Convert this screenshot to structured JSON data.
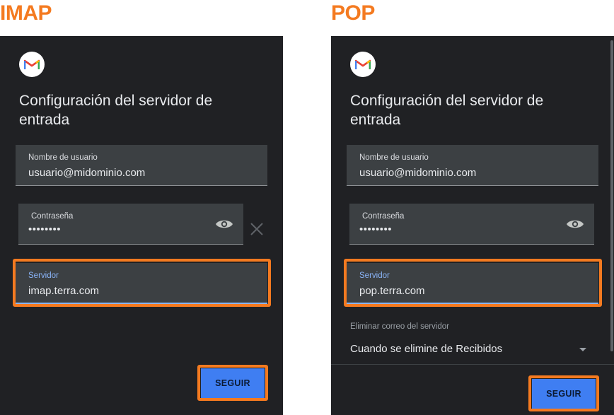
{
  "colors": {
    "accent": "#f47a20",
    "panel": "#202124",
    "field": "#3c4043",
    "button": "#3f7ef2",
    "focus": "#8ab4f8"
  },
  "imap": {
    "heading": "IMAP",
    "logo_icon": "gmail-logo-icon",
    "title": "Configuración del servidor de entrada",
    "username": {
      "label": "Nombre de usuario",
      "value": "usuario@midominio.com"
    },
    "password": {
      "label": "Contraseña",
      "value": "••••••••",
      "icon": "eye-icon"
    },
    "clear_icon": "close-icon",
    "server": {
      "label": "Servidor",
      "value": "imap.terra.com"
    },
    "button": "SEGUIR"
  },
  "pop": {
    "heading": "POP",
    "logo_icon": "gmail-logo-icon",
    "title": "Configuración del servidor de entrada",
    "username": {
      "label": "Nombre de usuario",
      "value": "usuario@midominio.com"
    },
    "password": {
      "label": "Contraseña",
      "value": "••••••••",
      "icon": "eye-icon"
    },
    "server": {
      "label": "Servidor",
      "value": "pop.terra.com"
    },
    "delete": {
      "label": "Eliminar correo del servidor",
      "value": "Cuando se elimine de Recibidos"
    },
    "button": "SEGUIR"
  }
}
